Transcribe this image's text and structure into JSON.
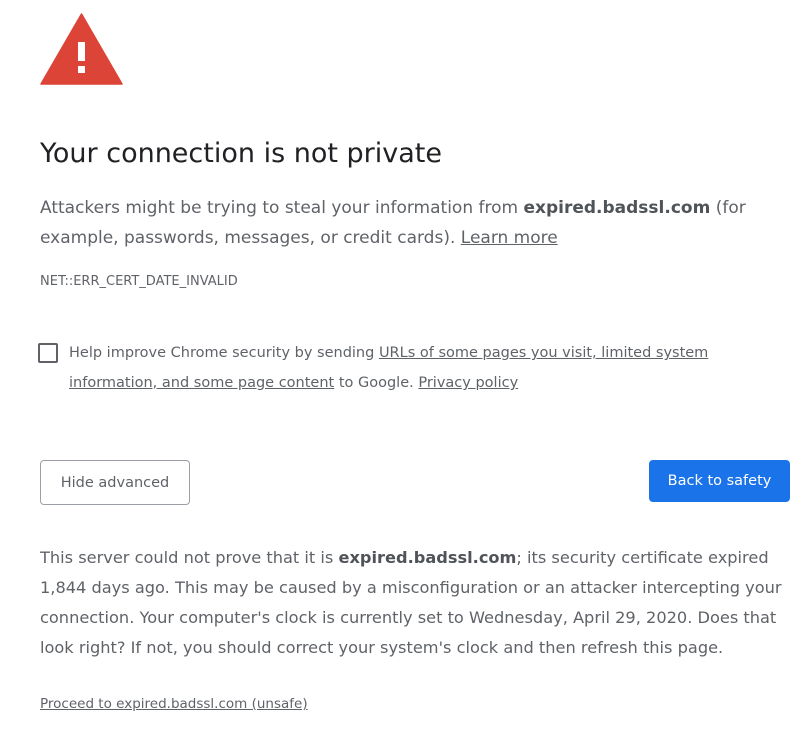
{
  "interstitial": {
    "heading": "Your connection is not private",
    "explanation": {
      "prefix": "Attackers might be trying to steal your information from ",
      "host": "expired.badssl.com",
      "suffix": " (for example, passwords, messages, or credit cards). ",
      "learn_more": "Learn more"
    },
    "error_code": "NET::ERR_CERT_DATE_INVALID",
    "opt_in": {
      "checked": false,
      "prefix": "Help improve Chrome security by sending ",
      "link": "URLs of some pages you visit, limited system information, and some page content",
      "middle": " to Google. ",
      "privacy_link": "Privacy policy"
    },
    "buttons": {
      "hide_advanced": "Hide advanced",
      "back_to_safety": "Back to safety"
    },
    "details": {
      "prefix": "This server could not prove that it is ",
      "host": "expired.badssl.com",
      "suffix": "; its security certificate expired 1,844 days ago. This may be caused by a misconfiguration or an attacker intercepting your connection. Your computer's clock is currently set to Wednesday, April 29, 2020. Does that look right? If not, you should correct your system's clock and then refresh this page."
    },
    "proceed_link": "Proceed to expired.badssl.com (unsafe)"
  },
  "colors": {
    "warning_red": "#db4437",
    "primary_blue": "#1a73e8",
    "heading_text": "#202124",
    "body_text": "#5f6368"
  },
  "icons": {
    "warning": "warning-triangle-icon"
  }
}
